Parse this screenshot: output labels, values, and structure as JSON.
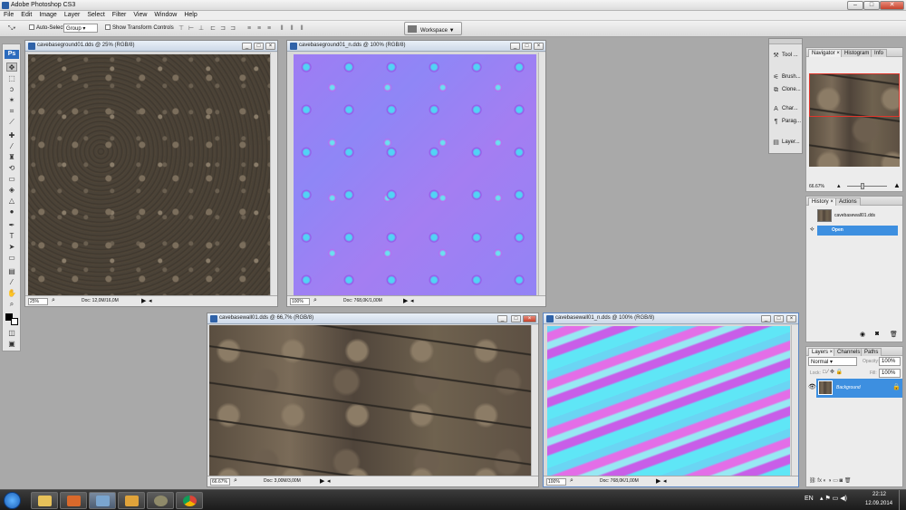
{
  "app": {
    "title": "Adobe Photoshop CS3"
  },
  "menus": [
    "File",
    "Edit",
    "Image",
    "Layer",
    "Select",
    "Filter",
    "View",
    "Window",
    "Help"
  ],
  "options_bar": {
    "auto_select_label": "Auto-Select:",
    "auto_select_value": "Group",
    "show_transform_label": "Show Transform Controls",
    "workspace_label": "Workspace ▼"
  },
  "toolbox": {
    "logo": "Ps"
  },
  "documents": [
    {
      "title": "cavebaseground01.dds @ 25% (RGB/8)",
      "zoom": "25%",
      "doc_info": "Doc: 12,0M/16,0M"
    },
    {
      "title": "cavebaseground01_n.dds @ 100% (RGB/8)",
      "zoom": "100%",
      "doc_info": "Doc: 768,0K/1,00M"
    },
    {
      "title": "cavebasewall01.dds @ 66,7% (RGB/8)",
      "zoom": "66.67%",
      "doc_info": "Doc: 3,00M/3,00M"
    },
    {
      "title": "cavebasewall01_n.dds @ 100% (RGB/8)",
      "zoom": "100%",
      "doc_info": "Doc: 768,0K/1,00M"
    }
  ],
  "mid_dock": [
    {
      "label": "Tool ...",
      "icon": "wrench-icon"
    },
    {
      "label": "Brush...",
      "icon": "brush-icon"
    },
    {
      "label": "Clone...",
      "icon": "clone-icon"
    },
    {
      "label": "Char...",
      "icon": "character-icon"
    },
    {
      "label": "Parag...",
      "icon": "paragraph-icon"
    },
    {
      "label": "Layer...",
      "icon": "layer-comps-icon"
    }
  ],
  "navigator": {
    "tabs": [
      "Navigator ×",
      "Histogram",
      "Info"
    ],
    "zoom": "66.67%"
  },
  "history": {
    "tabs": [
      "History ×",
      "Actions"
    ],
    "snapshot": "cavebasewall01.dds",
    "state": "Open"
  },
  "layers": {
    "tabs": [
      "Layers ×",
      "Channels",
      "Paths"
    ],
    "blend": "Normal",
    "opacity_label": "Opacity:",
    "opacity": "100%",
    "lock_label": "Lock:",
    "fill_label": "Fill:",
    "fill": "100%",
    "layer_name": "Background"
  },
  "tray": {
    "lang": "EN",
    "time": "22:12",
    "date": "12.09.2014"
  },
  "colors": {
    "accent": "#2f83d6",
    "selection": "#3d8fe0"
  }
}
